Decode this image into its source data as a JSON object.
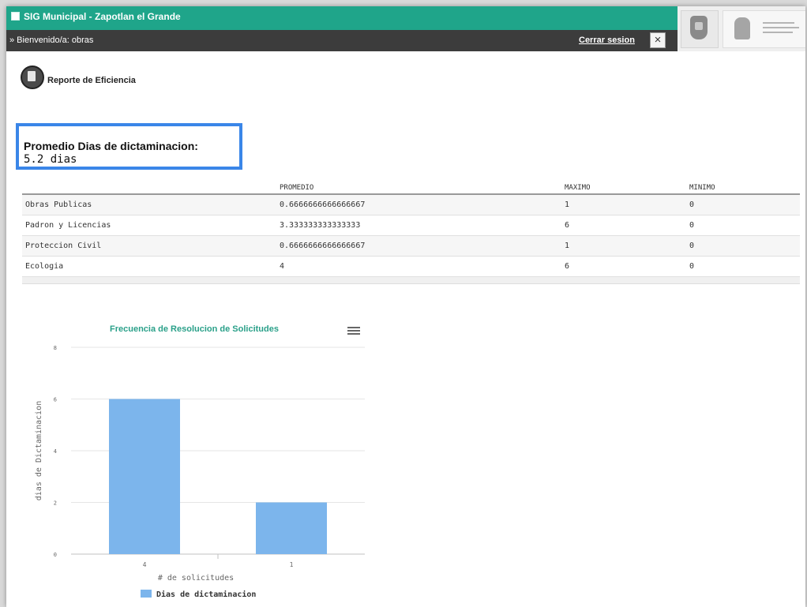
{
  "header": {
    "title": "SIG Municipal - Zapotlan el Grande",
    "welcome": "» Bienvenido/a: obras",
    "logout_label": "Cerrar sesion",
    "close_glyph": "×"
  },
  "report": {
    "title": "Reporte de Eficiencia"
  },
  "summary": {
    "label": "Promedio Dias de dictaminacion:",
    "value": "5.2 dias"
  },
  "table": {
    "columns": [
      "",
      "PROMEDIO",
      "MAXIMO",
      "MINIMO"
    ],
    "rows": [
      [
        "Obras Publicas",
        "0.6666666666666667",
        "1",
        "0"
      ],
      [
        "Padron y Licencias",
        "3.333333333333333",
        "6",
        "0"
      ],
      [
        "Proteccion Civil",
        "0.6666666666666667",
        "1",
        "0"
      ],
      [
        "Ecologia",
        "4",
        "6",
        "0"
      ]
    ]
  },
  "colors": {
    "topbar": "#1fa58a",
    "subbar": "#3c3c3c",
    "highlight_border": "#3a86e8",
    "bar": "#7cb5ec",
    "chart_title": "#2aa089"
  },
  "icons": {
    "report": "report-icon",
    "menu": "hamburger-menu-icon",
    "close": "close-icon"
  },
  "chart_data": {
    "type": "bar",
    "title": "Frecuencia de Resolucion de Solicitudes",
    "xlabel": "# de solicitudes",
    "ylabel": "dias de Dictaminacion",
    "categories": [
      "4",
      "1"
    ],
    "series": [
      {
        "name": "Dias de dictaminacion",
        "values": [
          6,
          2
        ]
      }
    ],
    "ylim": [
      0,
      8
    ],
    "yticks": [
      0,
      2,
      4,
      6,
      8
    ],
    "grid": true,
    "legend": "bottom-center"
  }
}
